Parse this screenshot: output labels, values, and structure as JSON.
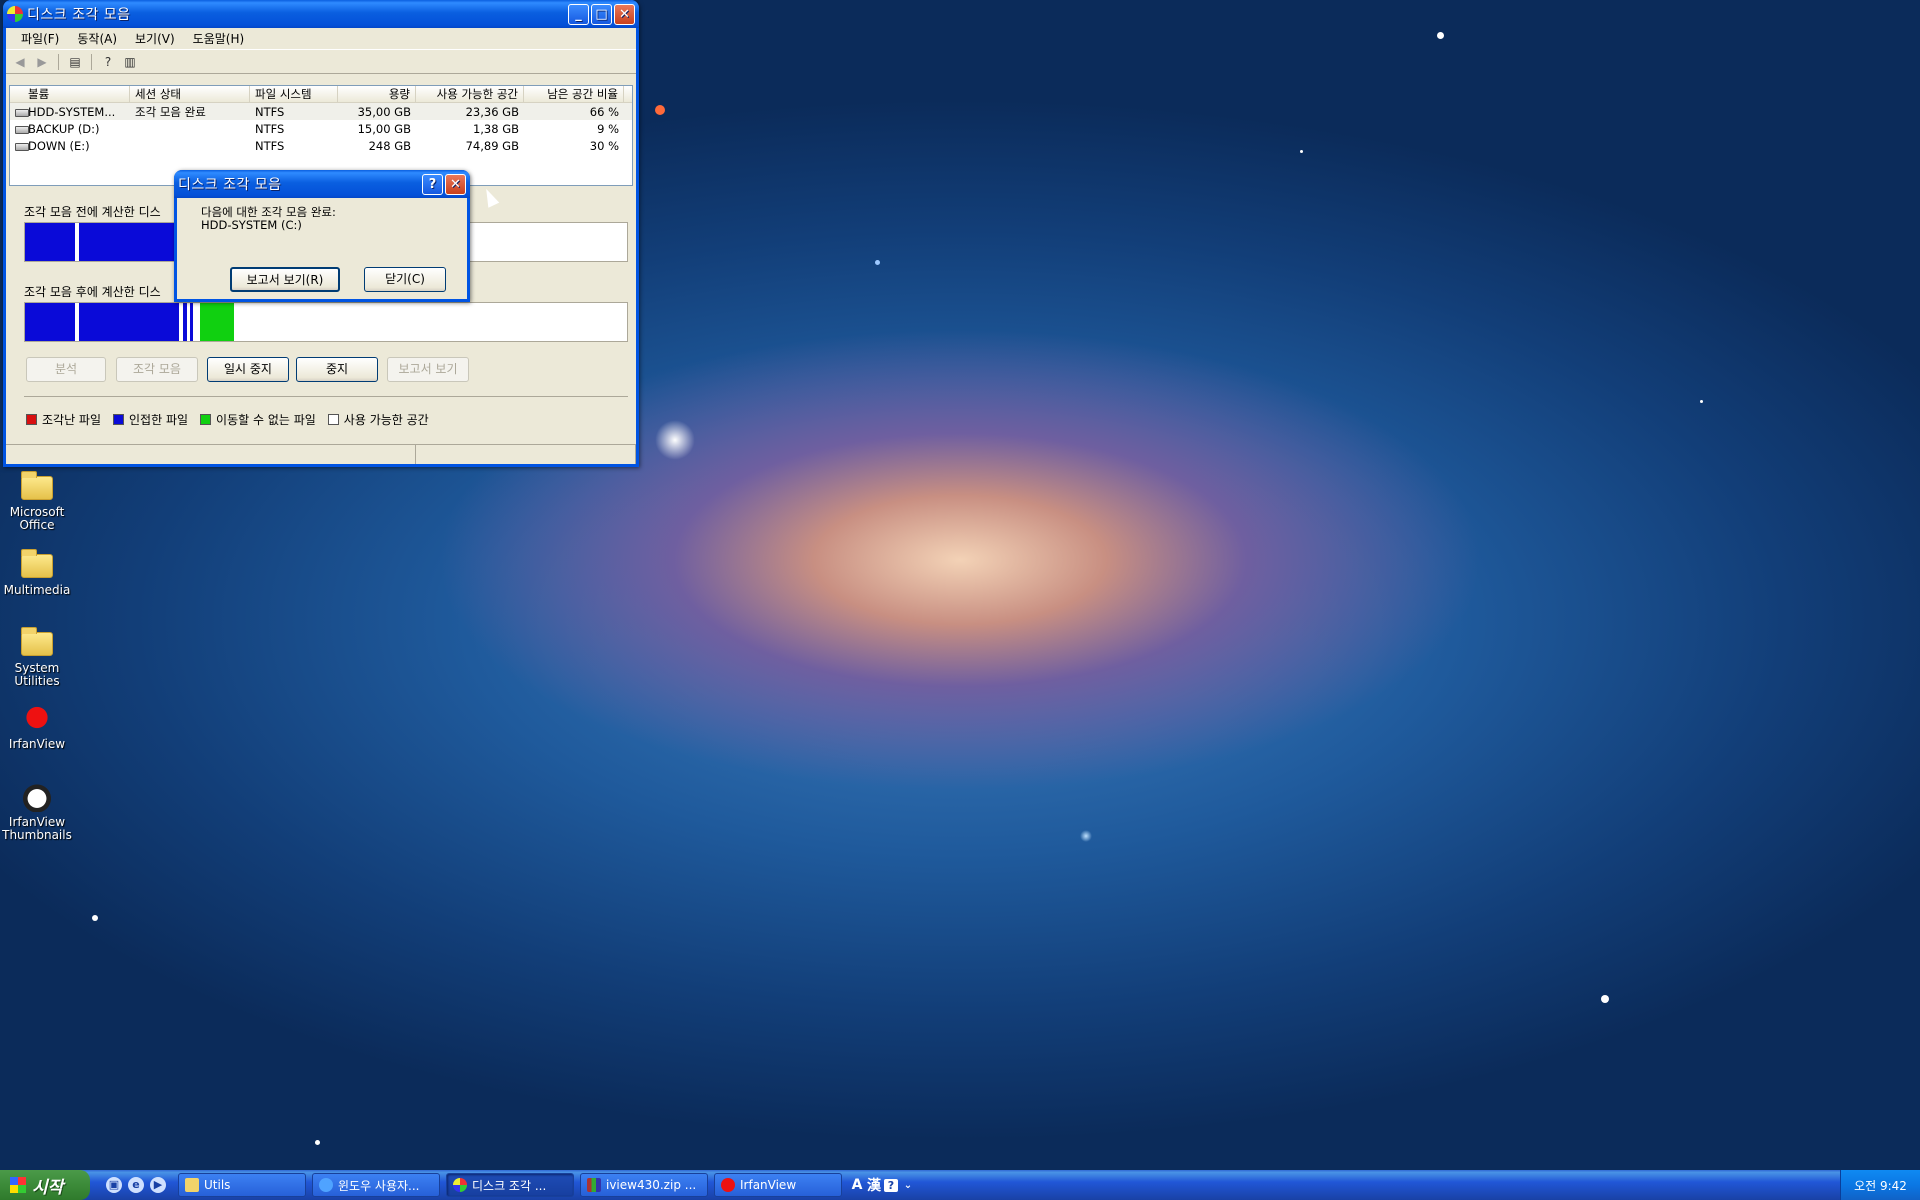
{
  "colors": {
    "fragmented": "#d81010",
    "contiguous": "#0a0ad8",
    "unmovable": "#10d010",
    "free": "#ffffff",
    "xp_blue": "#0054e3"
  },
  "main_window": {
    "title": "디스크 조각 모음",
    "menu": [
      "파일(F)",
      "동작(A)",
      "보기(V)",
      "도움말(H)"
    ],
    "toolbar_icons": [
      "back-icon",
      "forward-icon",
      "properties-icon",
      "help-icon",
      "view-icon"
    ],
    "columns": [
      "볼륨",
      "세션 상태",
      "파일 시스템",
      "용량",
      "사용 가능한 공간",
      "남은 공간 비율"
    ],
    "volumes": [
      {
        "name": "HDD-SYSTEM...",
        "status": "조각 모음 완료",
        "fs": "NTFS",
        "capacity": "35,00 GB",
        "free": "23,36 GB",
        "percent": "66 %"
      },
      {
        "name": "BACKUP (D:)",
        "status": "",
        "fs": "NTFS",
        "capacity": "15,00 GB",
        "free": "1,38 GB",
        "percent": "9 %"
      },
      {
        "name": "DOWN (E:)",
        "status": "",
        "fs": "NTFS",
        "capacity": "248 GB",
        "free": "74,89 GB",
        "percent": "30 %"
      }
    ],
    "before_label": "조각 모음 전에 계산한 디스",
    "after_label": "조각 모음 후에 계산한 디스",
    "buttons": {
      "analyze": "분석",
      "defrag": "조각 모음",
      "pause": "일시 중지",
      "stop": "중지",
      "report": "보고서 보기"
    },
    "legend": [
      "조각난 파일",
      "인접한 파일",
      "이동할 수 없는 파일",
      "사용 가능한 공간"
    ]
  },
  "dialog": {
    "title": "디스크 조각 모음",
    "message_line1": "다음에 대한 조각 모음 완료:",
    "message_line2": "HDD-SYSTEM (C:)",
    "view_report": "보고서 보기(R)",
    "close": "닫기(C)"
  },
  "desktop_icons": [
    {
      "label": "Microsoft Office",
      "icon": "folder-icon"
    },
    {
      "label": "Multimedia",
      "icon": "folder-icon"
    },
    {
      "label": "System Utilities",
      "icon": "folder-icon"
    },
    {
      "label": "IrfanView",
      "icon": "irfanview-icon"
    },
    {
      "label": "IrfanView Thumbnails",
      "icon": "panda-icon"
    }
  ],
  "taskbar": {
    "start_label": "시작",
    "tasks": [
      {
        "label": "Utils",
        "icon": "folder-icon"
      },
      {
        "label": "윈도우 사용자...",
        "icon": "ie-icon"
      },
      {
        "label": "디스크 조각 ...",
        "icon": "defrag-icon"
      },
      {
        "label": "iview430.zip ...",
        "icon": "zip-icon"
      },
      {
        "label": "IrfanView",
        "icon": "irfanview-icon"
      }
    ],
    "lang": [
      "A",
      "漢"
    ],
    "clock": "오전 9:42"
  }
}
